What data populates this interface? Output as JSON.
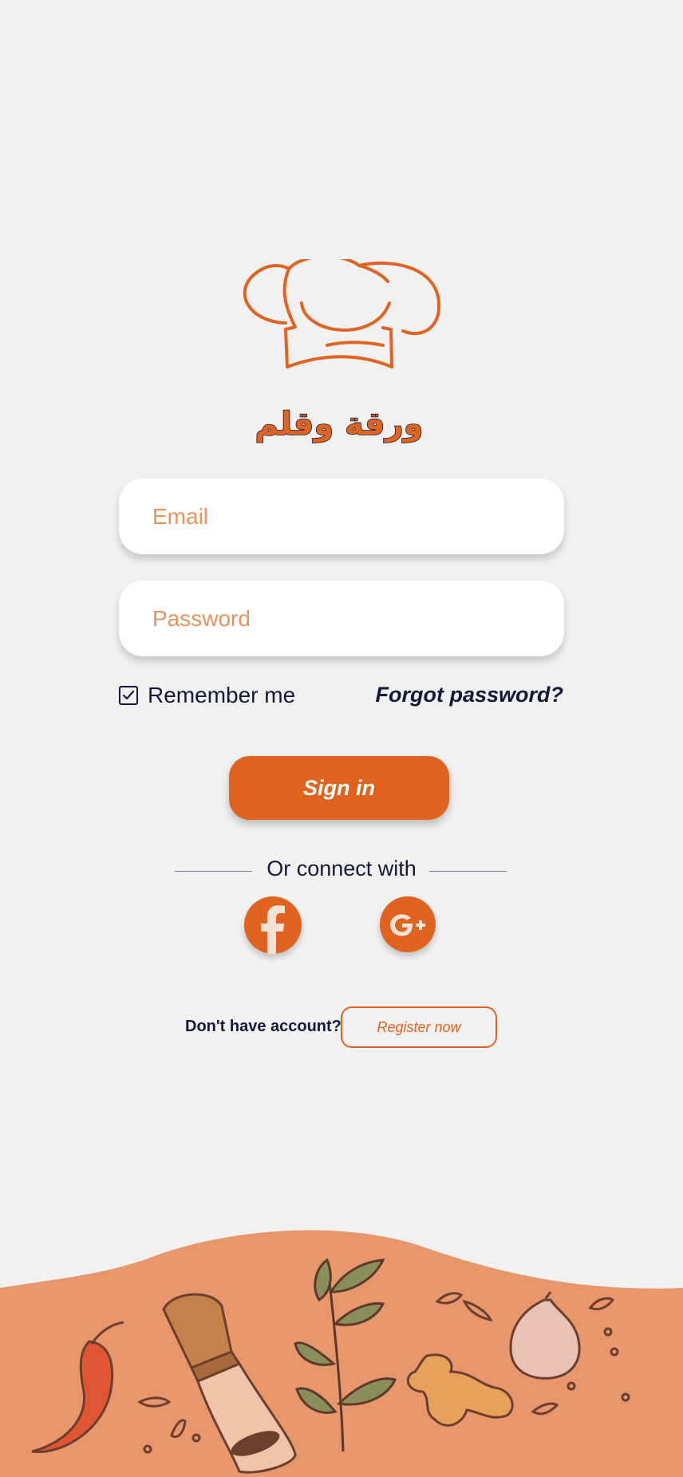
{
  "brand": {
    "arabic_name": "ورقة وقلم"
  },
  "form": {
    "email_placeholder": "Email",
    "password_placeholder": "Password",
    "remember_label": "Remember me",
    "remember_checked": true,
    "forgot_label": "Forgot password?",
    "signin_label": "Sign in"
  },
  "social": {
    "divider_text": "Or connect with",
    "providers": [
      {
        "name": "facebook-icon"
      },
      {
        "name": "google-plus-icon"
      }
    ]
  },
  "register": {
    "prompt": "Don't have account?",
    "button_label": "Register now"
  },
  "colors": {
    "accent": "#e0631f",
    "placeholder": "#e8935b",
    "footer": "#e8966b",
    "background": "#f2f1f2",
    "text": "#15183a"
  }
}
